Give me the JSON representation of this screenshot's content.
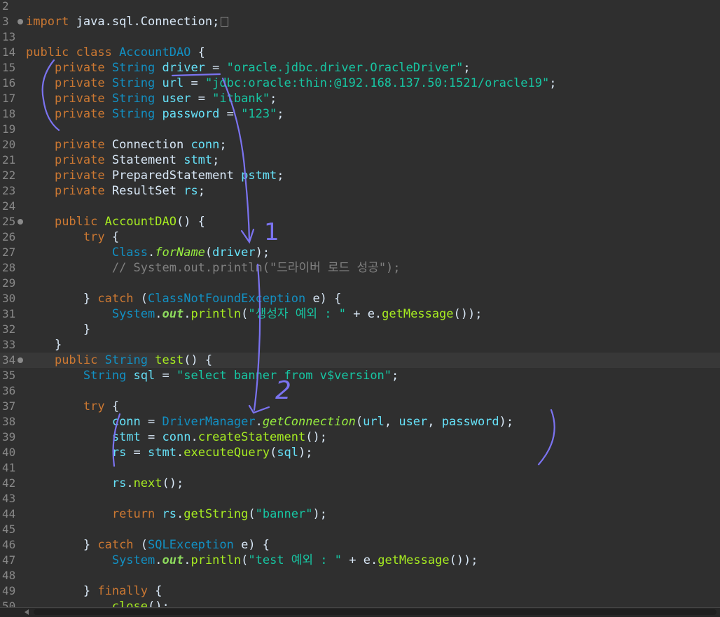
{
  "editor": {
    "lines": [
      {
        "num": "2",
        "segs": []
      },
      {
        "num": "3",
        "fold": true,
        "segs": [
          [
            "kw",
            "import"
          ],
          [
            "pl",
            " java.sql.Connection;"
          ]
        ],
        "folded_box": true
      },
      {
        "num": "13",
        "segs": []
      },
      {
        "num": "14",
        "segs": [
          [
            "kw",
            "public class "
          ],
          [
            "ty",
            "AccountDAO"
          ],
          [
            "pl",
            " {"
          ]
        ]
      },
      {
        "num": "15",
        "segs": [
          [
            "pl",
            "    "
          ],
          [
            "kw",
            "private "
          ],
          [
            "ty",
            "String "
          ],
          [
            "fd",
            "driver"
          ],
          [
            "pl",
            " = "
          ],
          [
            "st",
            "\"oracle.jdbc.driver.OracleDriver\""
          ],
          [
            "pl",
            ";"
          ]
        ]
      },
      {
        "num": "16",
        "segs": [
          [
            "pl",
            "    "
          ],
          [
            "kw",
            "private "
          ],
          [
            "ty",
            "String "
          ],
          [
            "fd",
            "url"
          ],
          [
            "pl",
            " = "
          ],
          [
            "st",
            "\"jdbc:oracle:thin:@192.168.137.50:1521/oracle19\""
          ],
          [
            "pl",
            ";"
          ]
        ]
      },
      {
        "num": "17",
        "segs": [
          [
            "pl",
            "    "
          ],
          [
            "kw",
            "private "
          ],
          [
            "ty",
            "String "
          ],
          [
            "fd",
            "user"
          ],
          [
            "pl",
            " = "
          ],
          [
            "st",
            "\"itbank\""
          ],
          [
            "pl",
            ";"
          ]
        ]
      },
      {
        "num": "18",
        "segs": [
          [
            "pl",
            "    "
          ],
          [
            "kw",
            "private "
          ],
          [
            "ty",
            "String "
          ],
          [
            "fd",
            "password"
          ],
          [
            "pl",
            " = "
          ],
          [
            "st",
            "\"123\""
          ],
          [
            "pl",
            ";"
          ]
        ]
      },
      {
        "num": "19",
        "segs": []
      },
      {
        "num": "20",
        "segs": [
          [
            "pl",
            "    "
          ],
          [
            "kw",
            "private "
          ],
          [
            "pl",
            "Connection "
          ],
          [
            "fd",
            "conn"
          ],
          [
            "pl",
            ";"
          ]
        ]
      },
      {
        "num": "21",
        "segs": [
          [
            "pl",
            "    "
          ],
          [
            "kw",
            "private "
          ],
          [
            "pl",
            "Statement "
          ],
          [
            "fd",
            "stmt"
          ],
          [
            "pl",
            ";"
          ]
        ]
      },
      {
        "num": "22",
        "segs": [
          [
            "pl",
            "    "
          ],
          [
            "kw",
            "private "
          ],
          [
            "pl",
            "PreparedStatement "
          ],
          [
            "fd",
            "pstmt"
          ],
          [
            "pl",
            ";"
          ]
        ]
      },
      {
        "num": "23",
        "segs": [
          [
            "pl",
            "    "
          ],
          [
            "kw",
            "private "
          ],
          [
            "pl",
            "ResultSet "
          ],
          [
            "fd",
            "rs"
          ],
          [
            "pl",
            ";"
          ]
        ]
      },
      {
        "num": "24",
        "segs": []
      },
      {
        "num": "25",
        "fold": true,
        "segs": [
          [
            "pl",
            "    "
          ],
          [
            "kw",
            "public "
          ],
          [
            "mt",
            "AccountDAO"
          ],
          [
            "pl",
            "() {"
          ]
        ]
      },
      {
        "num": "26",
        "segs": [
          [
            "pl",
            "        "
          ],
          [
            "kw",
            "try"
          ],
          [
            "pl",
            " {"
          ]
        ]
      },
      {
        "num": "27",
        "segs": [
          [
            "pl",
            "            "
          ],
          [
            "ty",
            "Class"
          ],
          [
            "pl",
            "."
          ],
          [
            "smt",
            "forName"
          ],
          [
            "pl",
            "("
          ],
          [
            "fd",
            "driver"
          ],
          [
            "pl",
            ");"
          ]
        ]
      },
      {
        "num": "28",
        "segs": [
          [
            "pl",
            "            "
          ],
          [
            "cm",
            "// System.out.println(\"드라이버 로드 성공\");"
          ]
        ]
      },
      {
        "num": "29",
        "segs": []
      },
      {
        "num": "30",
        "segs": [
          [
            "pl",
            "        } "
          ],
          [
            "kw",
            "catch"
          ],
          [
            "pl",
            " ("
          ],
          [
            "ty",
            "ClassNotFoundException"
          ],
          [
            "pl",
            " e) {"
          ]
        ]
      },
      {
        "num": "31",
        "segs": [
          [
            "pl",
            "            "
          ],
          [
            "ty",
            "System"
          ],
          [
            "pl",
            "."
          ],
          [
            "sfd",
            "out"
          ],
          [
            "pl",
            "."
          ],
          [
            "mt",
            "println"
          ],
          [
            "pl",
            "("
          ],
          [
            "st",
            "\"생성자 예외 : \""
          ],
          [
            "pl",
            " + e."
          ],
          [
            "mt",
            "getMessage"
          ],
          [
            "pl",
            "());"
          ]
        ]
      },
      {
        "num": "32",
        "segs": [
          [
            "pl",
            "        }"
          ]
        ]
      },
      {
        "num": "33",
        "segs": [
          [
            "pl",
            "    }"
          ]
        ]
      },
      {
        "num": "34",
        "fold": true,
        "current": true,
        "segs": [
          [
            "pl",
            "    "
          ],
          [
            "kw",
            "public "
          ],
          [
            "ty",
            "String "
          ],
          [
            "mt",
            "test"
          ],
          [
            "pl",
            "() {"
          ]
        ]
      },
      {
        "num": "35",
        "segs": [
          [
            "pl",
            "        "
          ],
          [
            "ty",
            "String "
          ],
          [
            "fd",
            "sql"
          ],
          [
            "pl",
            " = "
          ],
          [
            "st",
            "\"select banner from v$version\""
          ],
          [
            "pl",
            ";"
          ]
        ]
      },
      {
        "num": "36",
        "segs": []
      },
      {
        "num": "37",
        "segs": [
          [
            "pl",
            "        "
          ],
          [
            "kw",
            "try"
          ],
          [
            "pl",
            " {"
          ]
        ]
      },
      {
        "num": "38",
        "segs": [
          [
            "pl",
            "            "
          ],
          [
            "fd",
            "conn"
          ],
          [
            "pl",
            " = "
          ],
          [
            "ty",
            "DriverManager"
          ],
          [
            "pl",
            "."
          ],
          [
            "smt",
            "getConnection"
          ],
          [
            "pl",
            "("
          ],
          [
            "fd",
            "url"
          ],
          [
            "pl",
            ", "
          ],
          [
            "fd",
            "user"
          ],
          [
            "pl",
            ", "
          ],
          [
            "fd",
            "password"
          ],
          [
            "pl",
            ");"
          ]
        ]
      },
      {
        "num": "39",
        "segs": [
          [
            "pl",
            "            "
          ],
          [
            "fd",
            "stmt"
          ],
          [
            "pl",
            " = "
          ],
          [
            "fd",
            "conn"
          ],
          [
            "pl",
            "."
          ],
          [
            "mt",
            "createStatement"
          ],
          [
            "pl",
            "();"
          ]
        ]
      },
      {
        "num": "40",
        "segs": [
          [
            "pl",
            "            "
          ],
          [
            "fd",
            "rs"
          ],
          [
            "pl",
            " = "
          ],
          [
            "fd",
            "stmt"
          ],
          [
            "pl",
            "."
          ],
          [
            "mt",
            "executeQuery"
          ],
          [
            "pl",
            "("
          ],
          [
            "fd",
            "sql"
          ],
          [
            "pl",
            ");"
          ]
        ]
      },
      {
        "num": "41",
        "segs": []
      },
      {
        "num": "42",
        "segs": [
          [
            "pl",
            "            "
          ],
          [
            "fd",
            "rs"
          ],
          [
            "pl",
            "."
          ],
          [
            "mt",
            "next"
          ],
          [
            "pl",
            "();"
          ]
        ]
      },
      {
        "num": "43",
        "segs": []
      },
      {
        "num": "44",
        "segs": [
          [
            "pl",
            "            "
          ],
          [
            "kw",
            "return "
          ],
          [
            "fd",
            "rs"
          ],
          [
            "pl",
            "."
          ],
          [
            "mt",
            "getString"
          ],
          [
            "pl",
            "("
          ],
          [
            "st",
            "\"banner\""
          ],
          [
            "pl",
            ");"
          ]
        ]
      },
      {
        "num": "45",
        "segs": []
      },
      {
        "num": "46",
        "segs": [
          [
            "pl",
            "        } "
          ],
          [
            "kw",
            "catch"
          ],
          [
            "pl",
            " ("
          ],
          [
            "ty",
            "SQLException"
          ],
          [
            "pl",
            " e) {"
          ]
        ]
      },
      {
        "num": "47",
        "segs": [
          [
            "pl",
            "            "
          ],
          [
            "ty",
            "System"
          ],
          [
            "pl",
            "."
          ],
          [
            "sfd",
            "out"
          ],
          [
            "pl",
            "."
          ],
          [
            "mt",
            "println"
          ],
          [
            "pl",
            "("
          ],
          [
            "st",
            "\"test 예외 : \""
          ],
          [
            "pl",
            " + e."
          ],
          [
            "mt",
            "getMessage"
          ],
          [
            "pl",
            "());"
          ]
        ]
      },
      {
        "num": "48",
        "segs": []
      },
      {
        "num": "49",
        "segs": [
          [
            "pl",
            "        } "
          ],
          [
            "kw",
            "finally"
          ],
          [
            "pl",
            " {"
          ]
        ]
      },
      {
        "num": "50",
        "segs": [
          [
            "pl",
            "            "
          ],
          [
            "mt",
            "close"
          ],
          [
            "pl",
            "();"
          ]
        ]
      }
    ]
  },
  "annotations": {
    "label_1": "1",
    "label_2": "2",
    "ink_color": "#7b73f0"
  }
}
